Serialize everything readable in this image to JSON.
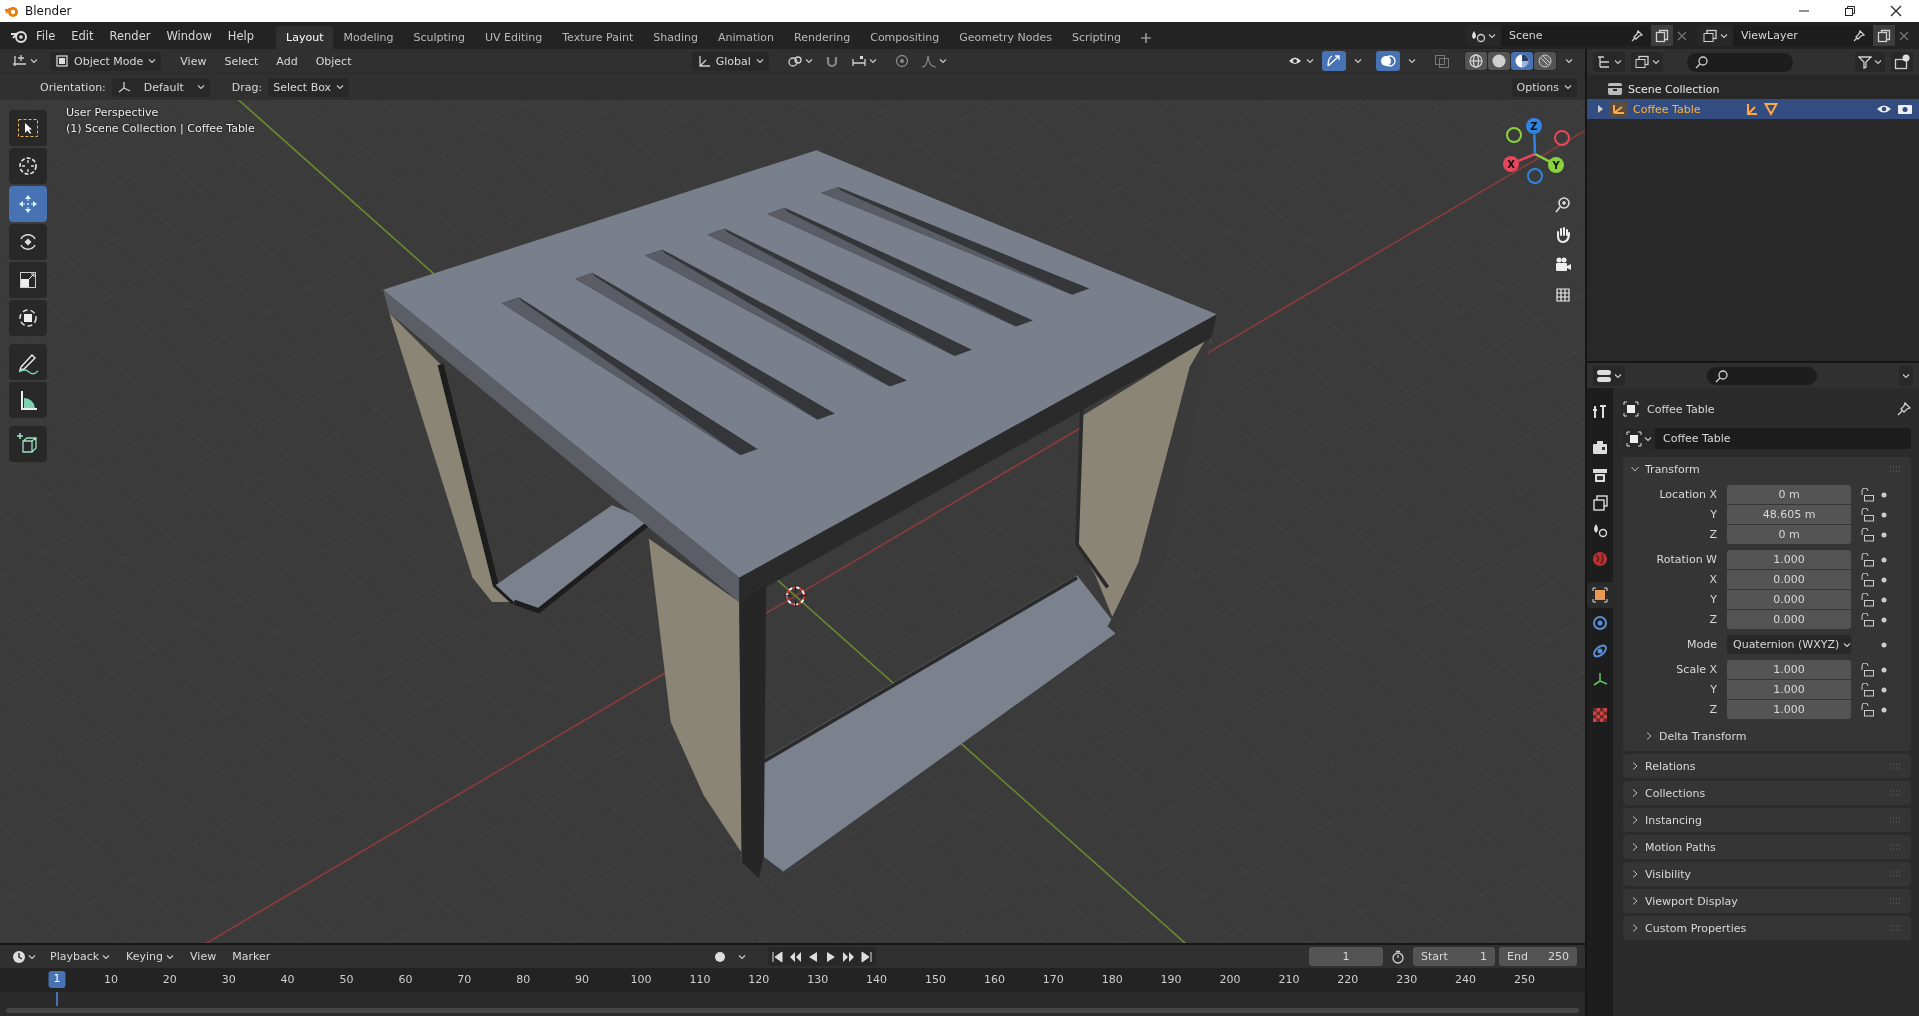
{
  "window": {
    "title": "Blender"
  },
  "menu": [
    "File",
    "Edit",
    "Render",
    "Window",
    "Help"
  ],
  "workspaces": [
    {
      "label": "Layout",
      "selected": true
    },
    {
      "label": "Modeling",
      "selected": false
    },
    {
      "label": "Sculpting",
      "selected": false
    },
    {
      "label": "UV Editing",
      "selected": false
    },
    {
      "label": "Texture Paint",
      "selected": false
    },
    {
      "label": "Shading",
      "selected": false
    },
    {
      "label": "Animation",
      "selected": false
    },
    {
      "label": "Rendering",
      "selected": false
    },
    {
      "label": "Compositing",
      "selected": false
    },
    {
      "label": "Geometry Nodes",
      "selected": false
    },
    {
      "label": "Scripting",
      "selected": false
    }
  ],
  "scene": {
    "name": "Scene"
  },
  "view_layer": {
    "name": "ViewLayer"
  },
  "viewport": {
    "header": {
      "mode": "Object Mode",
      "menus": [
        "View",
        "Select",
        "Add",
        "Object"
      ],
      "orientation": "Global",
      "gizmos": true,
      "overlays": true,
      "xray": false,
      "shading": [
        {
          "kind": "wireframe",
          "selected": false
        },
        {
          "kind": "solid",
          "selected": false
        },
        {
          "kind": "material",
          "selected": true
        },
        {
          "kind": "rendered",
          "selected": false
        }
      ]
    },
    "tool_settings": {
      "orientation_label": "Orientation:",
      "orientation": "Default",
      "drag_label": "Drag:",
      "drag": "Select Box",
      "options": "Options"
    },
    "info": [
      "User Perspective",
      "(1) Scene Collection | Coffee Table"
    ],
    "tools": [
      {
        "kind": "select_box",
        "selected": false
      },
      {
        "kind": "cursor",
        "selected": false
      },
      {
        "kind": "move",
        "selected": true
      },
      {
        "kind": "rotate",
        "selected": false
      },
      {
        "kind": "scale",
        "selected": false
      },
      {
        "kind": "transform",
        "selected": false
      },
      {
        "kind": "annotate",
        "selected": false
      },
      {
        "kind": "measure",
        "selected": false
      },
      {
        "kind": "add_cube",
        "selected": false
      }
    ],
    "gizmo_axes": [
      {
        "label": "X",
        "color": "#e8475b"
      },
      {
        "label": "Y",
        "color": "#8bd13c"
      },
      {
        "label": "Z",
        "color": "#2f85e3"
      }
    ]
  },
  "outliner": {
    "root": "Scene Collection",
    "items": [
      {
        "label": "Coffee Table",
        "selected": true,
        "expanded": false
      }
    ]
  },
  "properties": {
    "tabs": [
      {
        "kind": "tool",
        "selected": false
      },
      {
        "kind": "render",
        "selected": false
      },
      {
        "kind": "output",
        "selected": false
      },
      {
        "kind": "view_layer",
        "selected": false
      },
      {
        "kind": "scene",
        "selected": false
      },
      {
        "kind": "world",
        "selected": false
      },
      {
        "kind": "object",
        "selected": true
      },
      {
        "kind": "particles",
        "selected": false
      },
      {
        "kind": "physics",
        "selected": false
      },
      {
        "kind": "data",
        "selected": false
      },
      {
        "kind": "texture",
        "selected": false
      }
    ],
    "context": "Coffee Table",
    "name": "Coffee Table",
    "transform": {
      "title": "Transform",
      "expanded": true,
      "groups": [
        [
          {
            "kind": "number",
            "label": "Location X",
            "value": "0 m",
            "locked": false
          },
          {
            "kind": "number",
            "label": "Y",
            "value": "48.605 m",
            "locked": false
          },
          {
            "kind": "number",
            "label": "Z",
            "value": "0 m",
            "locked": false
          }
        ],
        [
          {
            "kind": "number",
            "label": "Rotation W",
            "value": "1.000",
            "locked": false
          },
          {
            "kind": "number",
            "label": "X",
            "value": "0.000",
            "locked": false
          },
          {
            "kind": "number",
            "label": "Y",
            "value": "0.000",
            "locked": false
          },
          {
            "kind": "number",
            "label": "Z",
            "value": "0.000",
            "locked": false
          }
        ],
        [
          {
            "kind": "dropdown",
            "label": "Mode",
            "value": "Quaternion (WXYZ)"
          }
        ],
        [
          {
            "kind": "number",
            "label": "Scale X",
            "value": "1.000",
            "locked": false
          },
          {
            "kind": "number",
            "label": "Y",
            "value": "1.000",
            "locked": false
          },
          {
            "kind": "number",
            "label": "Z",
            "value": "1.000",
            "locked": false
          }
        ]
      ],
      "subpanels": [
        {
          "title": "Delta Transform",
          "expanded": false
        }
      ]
    },
    "panels": [
      {
        "title": "Relations",
        "expanded": false
      },
      {
        "title": "Collections",
        "expanded": false
      },
      {
        "title": "Instancing",
        "expanded": false
      },
      {
        "title": "Motion Paths",
        "expanded": false
      },
      {
        "title": "Visibility",
        "expanded": false
      },
      {
        "title": "Viewport Display",
        "expanded": false
      },
      {
        "title": "Custom Properties",
        "expanded": false
      }
    ]
  },
  "timeline": {
    "menus": [
      {
        "label": "Playback",
        "kind": "dropdown"
      },
      {
        "label": "Keying",
        "kind": "dropdown"
      },
      {
        "label": "View",
        "kind": "menu"
      },
      {
        "label": "Marker",
        "kind": "menu"
      }
    ],
    "auto_keying": false,
    "current_frame": "1",
    "start": {
      "label": "Start",
      "value": "1"
    },
    "end": {
      "label": "End",
      "value": "250"
    },
    "playhead": "1",
    "ruler": [
      "10",
      "20",
      "30",
      "40",
      "50",
      "60",
      "70",
      "80",
      "90",
      "100",
      "110",
      "120",
      "130",
      "140",
      "150",
      "160",
      "170",
      "180",
      "190",
      "200",
      "210",
      "220",
      "230",
      "240",
      "250"
    ]
  }
}
